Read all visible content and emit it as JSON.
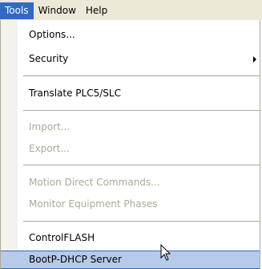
{
  "menubar": {
    "items": [
      {
        "label": "Tools",
        "active": true
      },
      {
        "label": "Window",
        "active": false
      },
      {
        "label": "Help",
        "active": false
      }
    ]
  },
  "menu": {
    "items": [
      {
        "label": "Options...",
        "enabled": true
      },
      {
        "label": "Security",
        "enabled": true,
        "submenu": true
      },
      {
        "label": "Translate PLC5/SLC",
        "enabled": true
      },
      {
        "label": "Import...",
        "enabled": false
      },
      {
        "label": "Export...",
        "enabled": false
      },
      {
        "label": "Motion Direct Commands...",
        "enabled": false
      },
      {
        "label": "Monitor Equipment Phases",
        "enabled": false
      },
      {
        "label": "ControlFLASH",
        "enabled": true
      },
      {
        "label": "BootP-DHCP Server",
        "enabled": true,
        "highlighted": true
      }
    ]
  },
  "colors": {
    "menubar_bg": "#ece9d8",
    "active_menu_bg": "#316ac5",
    "highlight_bg": "#b6caea",
    "disabled_text": "#aca899"
  },
  "icons": {
    "submenu": "chevron-right-icon",
    "cursor": "mouse-pointer-icon"
  }
}
